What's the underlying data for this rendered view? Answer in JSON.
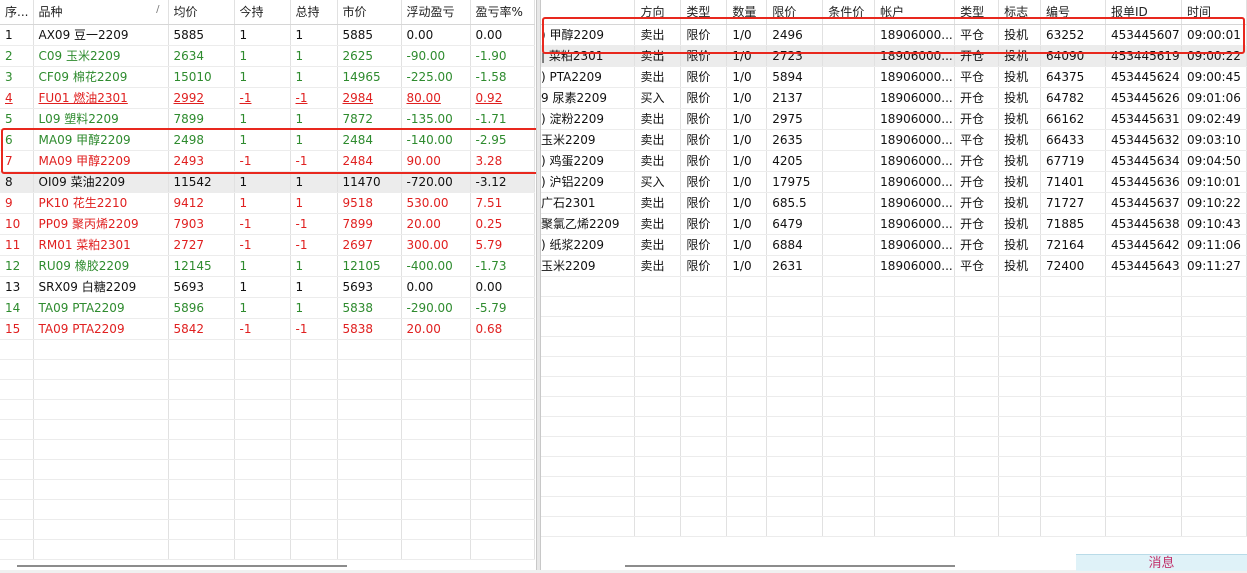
{
  "positions": {
    "headers": [
      "序...",
      "品种",
      "均价",
      "今持",
      "总持",
      "市价",
      "浮动盈亏",
      "盈亏率%"
    ],
    "sort_indicator": "/",
    "rows": [
      {
        "color": "black",
        "cells": [
          "1",
          "AX09 豆一2209",
          "5885",
          "1",
          "1",
          "5885",
          "0.00",
          "0.00"
        ]
      },
      {
        "color": "green",
        "cells": [
          "2",
          "C09 玉米2209",
          "2634",
          "1",
          "1",
          "2625",
          "-90.00",
          "-1.90"
        ]
      },
      {
        "color": "green",
        "cells": [
          "3",
          "CF09 棉花2209",
          "15010",
          "1",
          "1",
          "14965",
          "-225.00",
          "-1.58"
        ]
      },
      {
        "color": "red",
        "underline": true,
        "cells": [
          "4",
          "FU01 燃油2301",
          "2992",
          "-1",
          "-1",
          "2984",
          "80.00",
          "0.92"
        ]
      },
      {
        "color": "green",
        "cells": [
          "5",
          "L09 塑料2209",
          "7899",
          "1",
          "1",
          "7872",
          "-135.00",
          "-1.71"
        ]
      },
      {
        "color": "green",
        "cells": [
          "6",
          "MA09 甲醇2209",
          "2498",
          "1",
          "1",
          "2484",
          "-140.00",
          "-2.95"
        ]
      },
      {
        "color": "red",
        "cells": [
          "7",
          "MA09 甲醇2209",
          "2493",
          "-1",
          "-1",
          "2484",
          "90.00",
          "3.28"
        ]
      },
      {
        "color": "black",
        "selected": true,
        "cells": [
          "8",
          "OI09 菜油2209",
          "11542",
          "1",
          "1",
          "11470",
          "-720.00",
          "-3.12"
        ]
      },
      {
        "color": "red",
        "cells": [
          "9",
          "PK10 花生2210",
          "9412",
          "1",
          "1",
          "9518",
          "530.00",
          "7.51"
        ]
      },
      {
        "color": "red",
        "cells": [
          "10",
          "PP09 聚丙烯2209",
          "7903",
          "-1",
          "-1",
          "7899",
          "20.00",
          "0.25"
        ]
      },
      {
        "color": "red",
        "cells": [
          "11",
          "RM01 菜粕2301",
          "2727",
          "-1",
          "-1",
          "2697",
          "300.00",
          "5.79"
        ]
      },
      {
        "color": "green",
        "cells": [
          "12",
          "RU09 橡胶2209",
          "12145",
          "1",
          "1",
          "12105",
          "-400.00",
          "-1.73"
        ]
      },
      {
        "color": "black",
        "cells": [
          "13",
          "SRX09 白糖2209",
          "5693",
          "1",
          "1",
          "5693",
          "0.00",
          "0.00"
        ]
      },
      {
        "color": "green",
        "cells": [
          "14",
          "TA09 PTA2209",
          "5896",
          "1",
          "1",
          "5838",
          "-290.00",
          "-5.79"
        ]
      },
      {
        "color": "red",
        "cells": [
          "15",
          "TA09 PTA2209",
          "5842",
          "-1",
          "-1",
          "5838",
          "20.00",
          "0.68"
        ]
      }
    ]
  },
  "orders": {
    "headers": [
      "",
      "方向",
      "类型",
      "数量",
      "限价",
      "条件价",
      "帐户",
      "类型",
      "标志",
      "编号",
      "报单ID",
      "时间"
    ],
    "rows": [
      {
        "selected": false,
        "cells": [
          ") 甲醇2209",
          "卖出",
          "限价",
          "1/0",
          "2496",
          "",
          "18906000...",
          "平仓",
          "投机",
          "63252",
          "453445607",
          "09:00:01"
        ]
      },
      {
        "selected": true,
        "cells": [
          "| 菜粕2301",
          "卖出",
          "限价",
          "1/0",
          "2723",
          "",
          "18906000...",
          "开仓",
          "投机",
          "64090",
          "453445619",
          "09:00:22"
        ]
      },
      {
        "selected": false,
        "cells": [
          ") PTA2209",
          "卖出",
          "限价",
          "1/0",
          "5894",
          "",
          "18906000...",
          "平仓",
          "投机",
          "64375",
          "453445624",
          "09:00:45"
        ]
      },
      {
        "selected": false,
        "cells": [
          "9 尿素2209",
          "买入",
          "限价",
          "1/0",
          "2137",
          "",
          "18906000...",
          "开仓",
          "投机",
          "64782",
          "453445626",
          "09:01:06"
        ]
      },
      {
        "selected": false,
        "cells": [
          ") 淀粉2209",
          "卖出",
          "限价",
          "1/0",
          "2975",
          "",
          "18906000...",
          "开仓",
          "投机",
          "66162",
          "453445631",
          "09:02:49"
        ]
      },
      {
        "selected": false,
        "cells": [
          "玉米2209",
          "卖出",
          "限价",
          "1/0",
          "2635",
          "",
          "18906000...",
          "平仓",
          "投机",
          "66433",
          "453445632",
          "09:03:10"
        ]
      },
      {
        "selected": false,
        "cells": [
          ") 鸡蛋2209",
          "卖出",
          "限价",
          "1/0",
          "4205",
          "",
          "18906000...",
          "开仓",
          "投机",
          "67719",
          "453445634",
          "09:04:50"
        ]
      },
      {
        "selected": false,
        "cells": [
          ") 沪铝2209",
          "买入",
          "限价",
          "1/0",
          "17975",
          "",
          "18906000...",
          "开仓",
          "投机",
          "71401",
          "453445636",
          "09:10:01"
        ]
      },
      {
        "selected": false,
        "cells": [
          "广石2301",
          "卖出",
          "限价",
          "1/0",
          "685.5",
          "",
          "18906000...",
          "开仓",
          "投机",
          "71727",
          "453445637",
          "09:10:22"
        ]
      },
      {
        "selected": false,
        "cells": [
          "聚氯乙烯2209",
          "卖出",
          "限价",
          "1/0",
          "6479",
          "",
          "18906000...",
          "开仓",
          "投机",
          "71885",
          "453445638",
          "09:10:43"
        ]
      },
      {
        "selected": false,
        "cells": [
          ") 纸浆2209",
          "卖出",
          "限价",
          "1/0",
          "6884",
          "",
          "18906000...",
          "开仓",
          "投机",
          "72164",
          "453445642",
          "09:11:06"
        ]
      },
      {
        "selected": false,
        "cells": [
          "玉米2209",
          "卖出",
          "限价",
          "1/0",
          "2631",
          "",
          "18906000...",
          "平仓",
          "投机",
          "72400",
          "453445643",
          "09:11:27"
        ]
      }
    ]
  },
  "footer": {
    "message_tab": "消息"
  },
  "colors": {
    "positive": "#2e8b2e",
    "negative": "#e02020",
    "highlight": "#e8281e"
  }
}
